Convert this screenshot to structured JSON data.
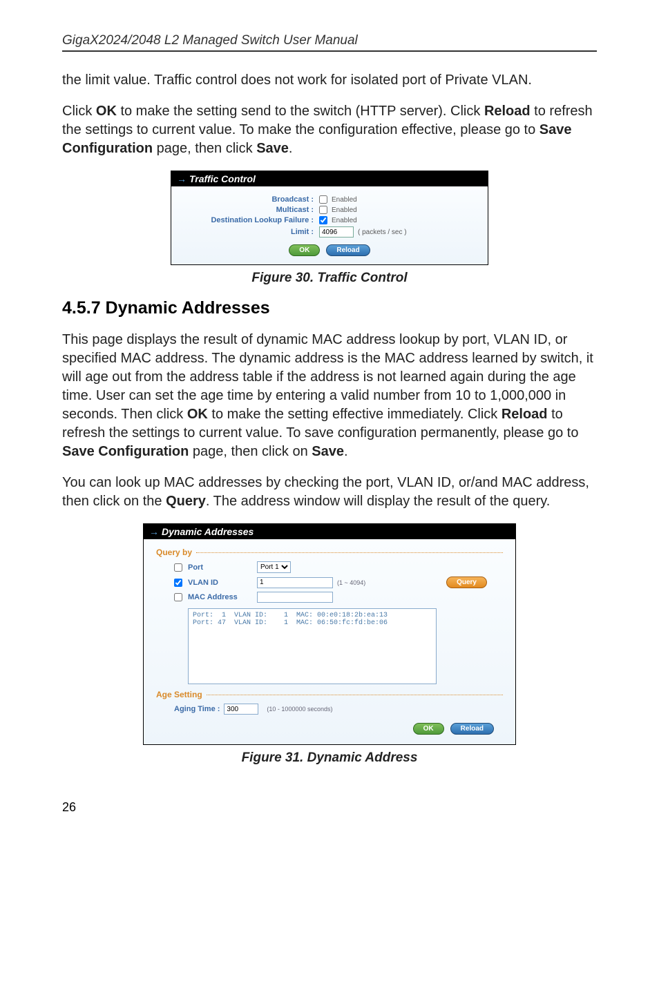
{
  "header": "GigaX2024/2048 L2 Managed Switch User Manual",
  "para1": "the limit value. Traffic control does not work for isolated port of Private VLAN.",
  "para2": {
    "t1": "Click ",
    "b1": "OK",
    "t2": " to make the setting send to the switch (HTTP server). Click ",
    "b2": "Reload",
    "t3": " to refresh the settings to current value. To make the configuration effective, please go to ",
    "b3": "Save Configuration",
    "t4": " page, then click ",
    "b4": "Save",
    "t5": "."
  },
  "fig30_caption": "Figure 30. Traffic Control",
  "section_heading": "4.5.7 Dynamic Addresses",
  "para3": {
    "t1": "This page displays the result of dynamic MAC address lookup by port, VLAN ID, or specified MAC address. The dynamic address is the MAC address learned by switch, it will age out from the address table if the address is not learned again during the age time. User can set the age time by entering a valid number from 10 to 1,000,000 in seconds. Then click ",
    "b1": "OK",
    "t2": " to make the setting effective immediately. Click ",
    "b2": "Reload",
    "t3": " to refresh the settings to current value. To save configuration permanently, please go to ",
    "b3": "Save Configuration",
    "t4": " page, then click on ",
    "b4": "Save",
    "t5": "."
  },
  "para4": {
    "t1": "You can look up MAC addresses by checking the port, VLAN ID, or/and MAC address, then click on the ",
    "b1": "Query",
    "t2": ". The address window will display the result of the query."
  },
  "fig31_caption": "Figure 31. Dynamic Address",
  "page_number": "26",
  "traffic_control": {
    "title": "Traffic Control",
    "rows": {
      "broadcast_label": "Broadcast :",
      "multicast_label": "Multicast :",
      "dlf_label": "Destination Lookup Failure :",
      "limit_label": "Limit :",
      "enabled_text": "Enabled",
      "limit_value": "4096",
      "limit_unit": "( packets / sec )"
    },
    "broadcast_checked": false,
    "multicast_checked": false,
    "dlf_checked": true,
    "ok_btn": "OK",
    "reload_btn": "Reload"
  },
  "dynamic_addresses": {
    "title": "Dynamic Addresses",
    "query_legend": "Query by",
    "port_label": "Port",
    "port_checked": false,
    "port_value": "Port 1",
    "vlan_label": "VLAN ID",
    "vlan_checked": true,
    "vlan_value": "1",
    "vlan_range": "(1 ~ 4094)",
    "mac_label": "MAC Address",
    "mac_checked": false,
    "mac_value": "",
    "query_btn": "Query",
    "result_text": "Port:  1  VLAN ID:    1  MAC: 00:e0:18:2b:ea:13\nPort: 47  VLAN ID:    1  MAC: 06:50:fc:fd:be:06",
    "age_legend": "Age Setting",
    "aging_label": "Aging Time :",
    "aging_value": "300",
    "aging_range": "(10 - 1000000 seconds)",
    "ok_btn": "OK",
    "reload_btn": "Reload"
  }
}
